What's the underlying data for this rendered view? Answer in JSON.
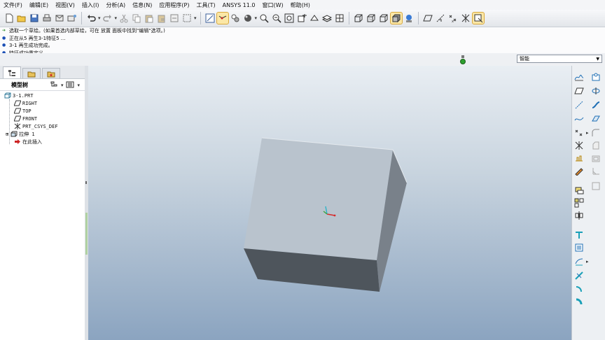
{
  "menu": [
    "文件(F)",
    "编辑(E)",
    "视图(V)",
    "插入(I)",
    "分析(A)",
    "信息(N)",
    "应用程序(P)",
    "工具(T)",
    "ANSYS 11.0",
    "窗口(W)",
    "帮助(H)"
  ],
  "messages": [
    "选取一个草绘。(如果首选内部草绘，可在 放置 面板中找到\"编辑\"选项。)",
    "正在从5 再生3-1特征5 ...",
    "3-1 再生成功完成。",
    "特征成功重定义。"
  ],
  "filter": {
    "value": "智能"
  },
  "model_tree": {
    "header": "模型树",
    "items": [
      "3-1.PRT",
      "RIGHT",
      "TOP",
      "FRONT",
      "PRT_CSYS_DEF",
      "拉伸 1",
      "在此插入"
    ]
  },
  "colors": {
    "viewport_top": "#e9eef3",
    "viewport_bottom": "#8ba4c0",
    "box_front": "#b9c3cd",
    "box_side": "#79818a",
    "box_bottom": "#4e555c",
    "insert_arrow": "#cc2222"
  }
}
